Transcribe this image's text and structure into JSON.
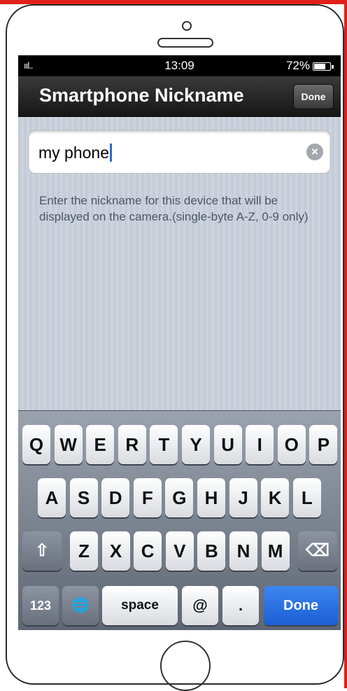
{
  "status": {
    "signal": "ııl..",
    "time": "13:09",
    "battery": "72%",
    "battery_level": 0.72
  },
  "navbar": {
    "title": "Smartphone Nickname",
    "done_label": "Done"
  },
  "nickname_field": {
    "value": "my phone",
    "clear_icon": "clear-icon"
  },
  "helper_text": "Enter the nickname for this device that will be displayed on the camera.(single-byte A-Z, 0-9 only)",
  "keyboard": {
    "row1": [
      "Q",
      "W",
      "E",
      "R",
      "T",
      "Y",
      "U",
      "I",
      "O",
      "P"
    ],
    "row2": [
      "A",
      "S",
      "D",
      "F",
      "G",
      "H",
      "J",
      "K",
      "L"
    ],
    "row3": [
      "Z",
      "X",
      "C",
      "V",
      "B",
      "N",
      "M"
    ],
    "shift_icon": "shift-icon",
    "delete_icon": "backspace-icon",
    "numbers_label": "123",
    "globe_icon": "globe-icon",
    "space_label": "space",
    "at_label": "@",
    "dot_label": ".",
    "done_label": "Done"
  },
  "colors": {
    "accent": "#1a5fd6",
    "frame_border": "#e0201b"
  }
}
